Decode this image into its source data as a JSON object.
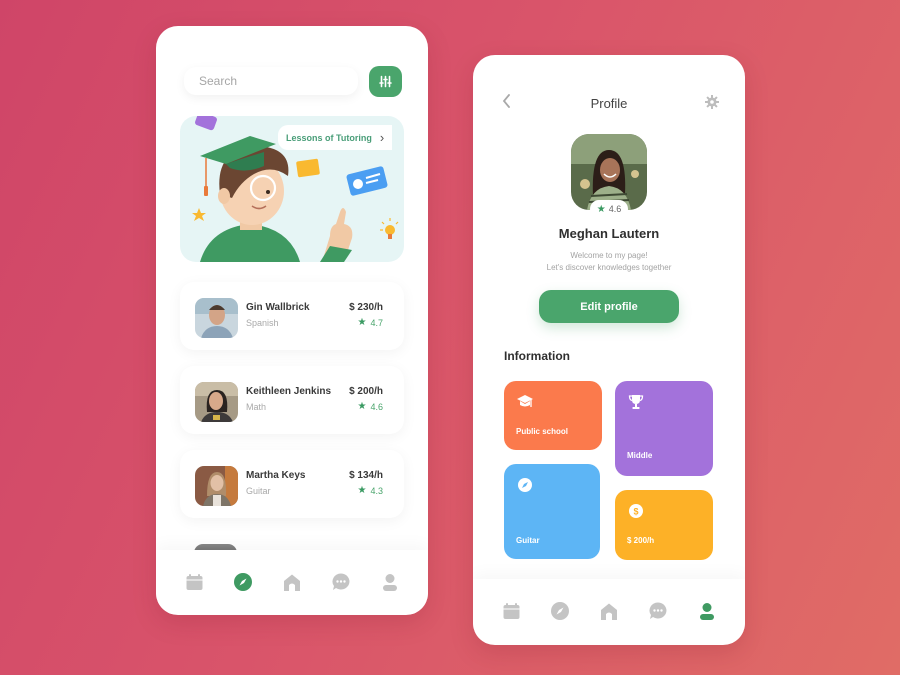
{
  "colors": {
    "accent_green": "#4aa56c",
    "tile_orange": "#fb7a4c",
    "tile_purple": "#a372db",
    "tile_blue": "#5db5f5",
    "tile_yellow": "#fdb127",
    "nav_inactive": "#c4c4c4"
  },
  "search": {
    "placeholder": "Search",
    "filter_icon": "sliders-icon"
  },
  "banner": {
    "label": "Lessons of Tutoring",
    "chevron": "›"
  },
  "tutors": [
    {
      "name": "Gin Wallbrick",
      "subject": "Spanish",
      "price": "$ 230/h",
      "rating": "4.7"
    },
    {
      "name": "Keithleen Jenkins",
      "subject": "Math",
      "price": "$ 200/h",
      "rating": "4.6"
    },
    {
      "name": "Martha Keys",
      "subject": "Guitar",
      "price": "$ 134/h",
      "rating": "4.3"
    }
  ],
  "left_nav": {
    "items": [
      "calendar-icon",
      "compass-icon",
      "home-icon",
      "chat-icon",
      "user-icon"
    ],
    "active": "compass-icon"
  },
  "profile": {
    "title": "Profile",
    "name": "Meghan Lautern",
    "rating": "4.6",
    "bio_line1": "Welcome to my page!",
    "bio_line2": "Let's discover knowledges together",
    "edit_label": "Edit profile",
    "info_heading": "Information",
    "tiles": [
      {
        "icon": "graduation-cap-icon",
        "label": "Public school"
      },
      {
        "icon": "trophy-icon",
        "label": "Middle"
      },
      {
        "icon": "compass-icon",
        "label": "Guitar"
      },
      {
        "icon": "dollar-coin-icon",
        "label": "$ 200/h"
      }
    ]
  },
  "right_nav": {
    "items": [
      "calendar-icon",
      "compass-icon",
      "home-icon",
      "chat-icon",
      "user-icon"
    ],
    "active": "user-icon"
  }
}
